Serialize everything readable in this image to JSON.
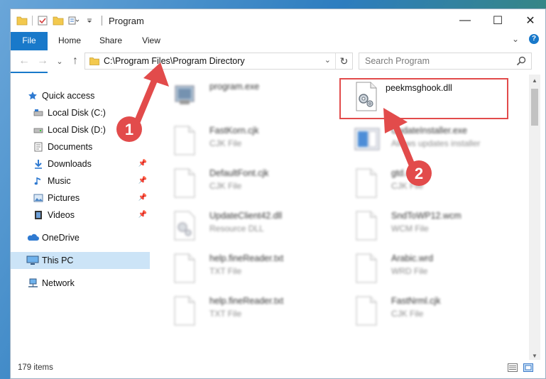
{
  "window": {
    "title": "Program",
    "controls": {
      "minimize": "—",
      "maximize": "☐",
      "close": "✕"
    }
  },
  "ribbon": {
    "tabs": [
      "File",
      "Home",
      "Share",
      "View"
    ],
    "collapse_glyph": "⌄",
    "help_glyph": "?"
  },
  "address": {
    "path": "C:\\Program Files\\Program Directory",
    "dropdown_glyph": "⌄",
    "refresh_glyph": "↻"
  },
  "nav_buttons": {
    "back": "←",
    "forward": "→",
    "recent": "⌄",
    "up": "↑"
  },
  "search": {
    "placeholder": "Search Program"
  },
  "sidebar": {
    "items": [
      {
        "label": "Quick access",
        "icon": "star-icon"
      },
      {
        "label": "Local Disk (C:)",
        "icon": "drive-icon"
      },
      {
        "label": "Local Disk (D:)",
        "icon": "drive-icon"
      },
      {
        "label": "Documents",
        "icon": "documents-icon"
      },
      {
        "label": "Downloads",
        "icon": "download-icon",
        "pinned": true
      },
      {
        "label": "Music",
        "icon": "music-icon",
        "pinned": true
      },
      {
        "label": "Pictures",
        "icon": "pictures-icon",
        "pinned": true
      },
      {
        "label": "Videos",
        "icon": "videos-icon",
        "pinned": true
      },
      {
        "label": "OneDrive",
        "icon": "cloud-icon"
      },
      {
        "label": "This PC",
        "icon": "pc-icon",
        "selected": true
      },
      {
        "label": "Network",
        "icon": "network-icon"
      }
    ]
  },
  "files": [
    {
      "name": "program.exe",
      "type": "",
      "icon": "exe-icon",
      "blurred": true
    },
    {
      "name": "peekmsghook.dll",
      "type": "",
      "icon": "dll-gear-icon",
      "blurred": false
    },
    {
      "name": "FastKorn.cjk",
      "type": "CJK File",
      "icon": "file-icon",
      "blurred": true
    },
    {
      "name": "UpdateInstaller.exe",
      "type": "Allows updates installer",
      "icon": "installer-icon",
      "blurred": true
    },
    {
      "name": "DefaultFont.cjk",
      "type": "CJK File",
      "icon": "file-icon",
      "blurred": true
    },
    {
      "name": "gtd.cjk",
      "type": "CJK File",
      "icon": "file-icon",
      "blurred": true
    },
    {
      "name": "UpdateClient42.dll",
      "type": "Resource DLL",
      "icon": "dll-gear-icon",
      "blurred": true
    },
    {
      "name": "SndToWP12.wcm",
      "type": "WCM File",
      "icon": "file-icon",
      "blurred": true
    },
    {
      "name": "help.fineReader.txt",
      "type": "TXT File",
      "icon": "file-icon",
      "blurred": true
    },
    {
      "name": "Arabic.wrd",
      "type": "WRD File",
      "icon": "file-icon",
      "blurred": true
    },
    {
      "name": "help.fineReader.txt",
      "type": "TXT File",
      "icon": "file-icon",
      "blurred": true
    },
    {
      "name": "FastNrml.cjk",
      "type": "CJK File",
      "icon": "file-icon",
      "blurred": true
    }
  ],
  "annotations": {
    "step1": "1",
    "step2": "2",
    "color": "#e24b4b"
  },
  "status": {
    "items_count": "179 items"
  }
}
